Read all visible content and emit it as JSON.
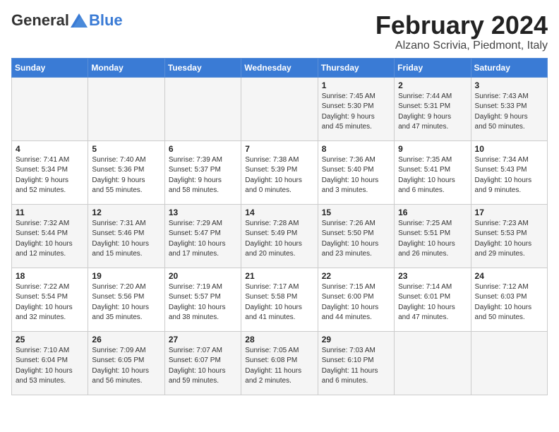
{
  "header": {
    "logo_general": "General",
    "logo_blue": "Blue",
    "month": "February 2024",
    "location": "Alzano Scrivia, Piedmont, Italy"
  },
  "days_of_week": [
    "Sunday",
    "Monday",
    "Tuesday",
    "Wednesday",
    "Thursday",
    "Friday",
    "Saturday"
  ],
  "weeks": [
    [
      {
        "day": "",
        "info": ""
      },
      {
        "day": "",
        "info": ""
      },
      {
        "day": "",
        "info": ""
      },
      {
        "day": "",
        "info": ""
      },
      {
        "day": "1",
        "info": "Sunrise: 7:45 AM\nSunset: 5:30 PM\nDaylight: 9 hours\nand 45 minutes."
      },
      {
        "day": "2",
        "info": "Sunrise: 7:44 AM\nSunset: 5:31 PM\nDaylight: 9 hours\nand 47 minutes."
      },
      {
        "day": "3",
        "info": "Sunrise: 7:43 AM\nSunset: 5:33 PM\nDaylight: 9 hours\nand 50 minutes."
      }
    ],
    [
      {
        "day": "4",
        "info": "Sunrise: 7:41 AM\nSunset: 5:34 PM\nDaylight: 9 hours\nand 52 minutes."
      },
      {
        "day": "5",
        "info": "Sunrise: 7:40 AM\nSunset: 5:36 PM\nDaylight: 9 hours\nand 55 minutes."
      },
      {
        "day": "6",
        "info": "Sunrise: 7:39 AM\nSunset: 5:37 PM\nDaylight: 9 hours\nand 58 minutes."
      },
      {
        "day": "7",
        "info": "Sunrise: 7:38 AM\nSunset: 5:39 PM\nDaylight: 10 hours\nand 0 minutes."
      },
      {
        "day": "8",
        "info": "Sunrise: 7:36 AM\nSunset: 5:40 PM\nDaylight: 10 hours\nand 3 minutes."
      },
      {
        "day": "9",
        "info": "Sunrise: 7:35 AM\nSunset: 5:41 PM\nDaylight: 10 hours\nand 6 minutes."
      },
      {
        "day": "10",
        "info": "Sunrise: 7:34 AM\nSunset: 5:43 PM\nDaylight: 10 hours\nand 9 minutes."
      }
    ],
    [
      {
        "day": "11",
        "info": "Sunrise: 7:32 AM\nSunset: 5:44 PM\nDaylight: 10 hours\nand 12 minutes."
      },
      {
        "day": "12",
        "info": "Sunrise: 7:31 AM\nSunset: 5:46 PM\nDaylight: 10 hours\nand 15 minutes."
      },
      {
        "day": "13",
        "info": "Sunrise: 7:29 AM\nSunset: 5:47 PM\nDaylight: 10 hours\nand 17 minutes."
      },
      {
        "day": "14",
        "info": "Sunrise: 7:28 AM\nSunset: 5:49 PM\nDaylight: 10 hours\nand 20 minutes."
      },
      {
        "day": "15",
        "info": "Sunrise: 7:26 AM\nSunset: 5:50 PM\nDaylight: 10 hours\nand 23 minutes."
      },
      {
        "day": "16",
        "info": "Sunrise: 7:25 AM\nSunset: 5:51 PM\nDaylight: 10 hours\nand 26 minutes."
      },
      {
        "day": "17",
        "info": "Sunrise: 7:23 AM\nSunset: 5:53 PM\nDaylight: 10 hours\nand 29 minutes."
      }
    ],
    [
      {
        "day": "18",
        "info": "Sunrise: 7:22 AM\nSunset: 5:54 PM\nDaylight: 10 hours\nand 32 minutes."
      },
      {
        "day": "19",
        "info": "Sunrise: 7:20 AM\nSunset: 5:56 PM\nDaylight: 10 hours\nand 35 minutes."
      },
      {
        "day": "20",
        "info": "Sunrise: 7:19 AM\nSunset: 5:57 PM\nDaylight: 10 hours\nand 38 minutes."
      },
      {
        "day": "21",
        "info": "Sunrise: 7:17 AM\nSunset: 5:58 PM\nDaylight: 10 hours\nand 41 minutes."
      },
      {
        "day": "22",
        "info": "Sunrise: 7:15 AM\nSunset: 6:00 PM\nDaylight: 10 hours\nand 44 minutes."
      },
      {
        "day": "23",
        "info": "Sunrise: 7:14 AM\nSunset: 6:01 PM\nDaylight: 10 hours\nand 47 minutes."
      },
      {
        "day": "24",
        "info": "Sunrise: 7:12 AM\nSunset: 6:03 PM\nDaylight: 10 hours\nand 50 minutes."
      }
    ],
    [
      {
        "day": "25",
        "info": "Sunrise: 7:10 AM\nSunset: 6:04 PM\nDaylight: 10 hours\nand 53 minutes."
      },
      {
        "day": "26",
        "info": "Sunrise: 7:09 AM\nSunset: 6:05 PM\nDaylight: 10 hours\nand 56 minutes."
      },
      {
        "day": "27",
        "info": "Sunrise: 7:07 AM\nSunset: 6:07 PM\nDaylight: 10 hours\nand 59 minutes."
      },
      {
        "day": "28",
        "info": "Sunrise: 7:05 AM\nSunset: 6:08 PM\nDaylight: 11 hours\nand 2 minutes."
      },
      {
        "day": "29",
        "info": "Sunrise: 7:03 AM\nSunset: 6:10 PM\nDaylight: 11 hours\nand 6 minutes."
      },
      {
        "day": "",
        "info": ""
      },
      {
        "day": "",
        "info": ""
      }
    ]
  ]
}
